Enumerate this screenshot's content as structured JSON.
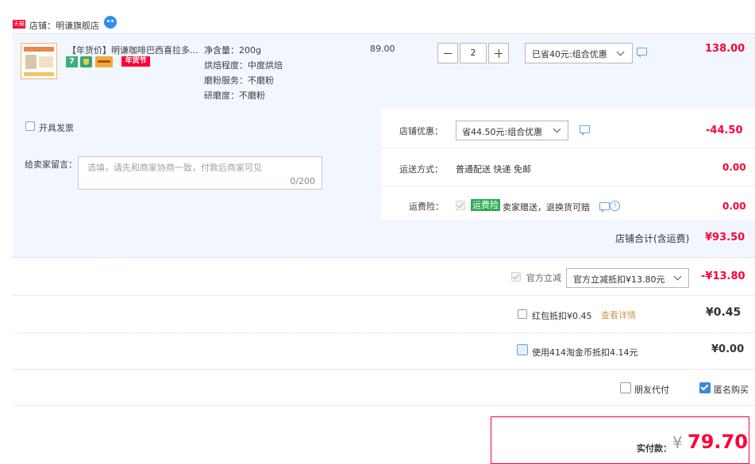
{
  "shop": {
    "badge": "天猫",
    "label": "店铺：",
    "name": "明谦旗舰店"
  },
  "item": {
    "title": "【年货价】明谦咖啡巴西喜拉多...",
    "tag": "年货节",
    "specs": [
      "净含量：200g",
      "烘焙程度：中度烘焙",
      "磨粉服务：不磨粉",
      "研磨度：不磨粉"
    ],
    "unit_price": "89.00",
    "quantity": "2",
    "discount_select": "已省40元:组合优惠",
    "subtotal": "138.00"
  },
  "invoice": {
    "label": "开具发票"
  },
  "message": {
    "label": "给卖家留言：",
    "placeholder": "选填，请先和商家协商一致，付款后商家可见",
    "counter": "0/200"
  },
  "shop_discount": {
    "label": "店铺优惠：",
    "select": "省44.50元:组合优惠",
    "amount": "-44.50"
  },
  "shipping": {
    "label": "运送方式：",
    "value": "普通配送 快递 免邮",
    "amount": "0.00"
  },
  "insurance": {
    "label": "运费险：",
    "badge": "运费险",
    "text": "卖家赠送，退换货可赔",
    "amount": "0.00"
  },
  "shop_total": {
    "label": "店铺合计(含运费)",
    "amount": "¥93.50"
  },
  "official": {
    "label": "官方立减",
    "select": "官方立减抵扣¥13.80元",
    "amount": "-¥13.80"
  },
  "redpacket": {
    "label": "红包抵扣¥0.45",
    "link": "查看详情",
    "amount": "¥0.45"
  },
  "taojinbi": {
    "label": "使用414淘金币抵扣4.14元",
    "amount": "¥0.00"
  },
  "options": {
    "friend_pay": "朋友代付",
    "anonymous": "匿名购买"
  },
  "payment": {
    "label": "实付款：",
    "currency": "¥",
    "amount": "79.70"
  },
  "colors": {
    "accent_red": "#ff0036",
    "panel_bg": "#f2f7ff",
    "link_blue": "#3d87d9",
    "tag_green": "#2dab52"
  }
}
